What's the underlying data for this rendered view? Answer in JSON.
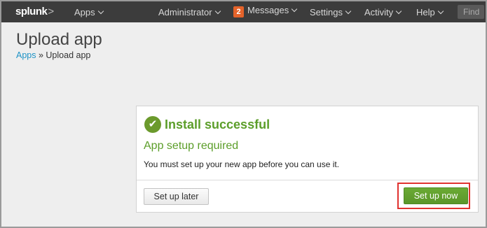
{
  "topbar": {
    "logo": "splunk",
    "logo_suffix": ">",
    "apps": "Apps",
    "administrator": "Administrator",
    "messages_count": "2",
    "messages": "Messages",
    "settings": "Settings",
    "activity": "Activity",
    "help": "Help",
    "find_placeholder": "Find"
  },
  "page": {
    "title": "Upload app",
    "breadcrumb_link": "Apps",
    "breadcrumb_sep": " » ",
    "breadcrumb_current": "Upload app"
  },
  "dialog": {
    "check_glyph": "✔",
    "heading": "Install successful",
    "subheading": "App setup required",
    "message": "You must set up your new app before you can use it.",
    "later_label": "Set up later",
    "now_label": "Set up now"
  },
  "colors": {
    "topbar_bg": "#3c3c3c",
    "accent_green": "#5c9e2a",
    "badge_orange": "#e5632a",
    "link_blue": "#1e93c6",
    "highlight_red": "#e0322f"
  }
}
